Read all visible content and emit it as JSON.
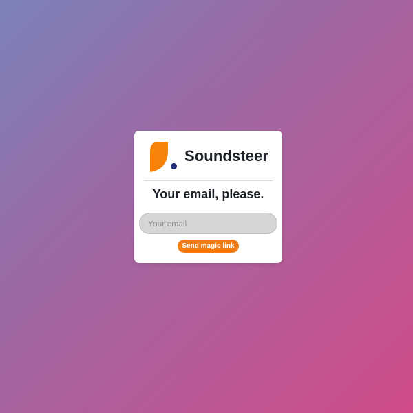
{
  "brand": {
    "name": "Soundsteer",
    "logo_icon": "soundsteer-logo-icon",
    "logo_colors": {
      "leaf": "#f5820a",
      "dot": "#1f2d7a"
    }
  },
  "form": {
    "heading": "Your email, please.",
    "email_placeholder": "Your email",
    "email_value": "",
    "submit_label": "Send magic link"
  },
  "colors": {
    "accent": "#f07b12",
    "text": "#1c2027",
    "background_start": "#7b82b8",
    "background_end": "#d04c88"
  }
}
